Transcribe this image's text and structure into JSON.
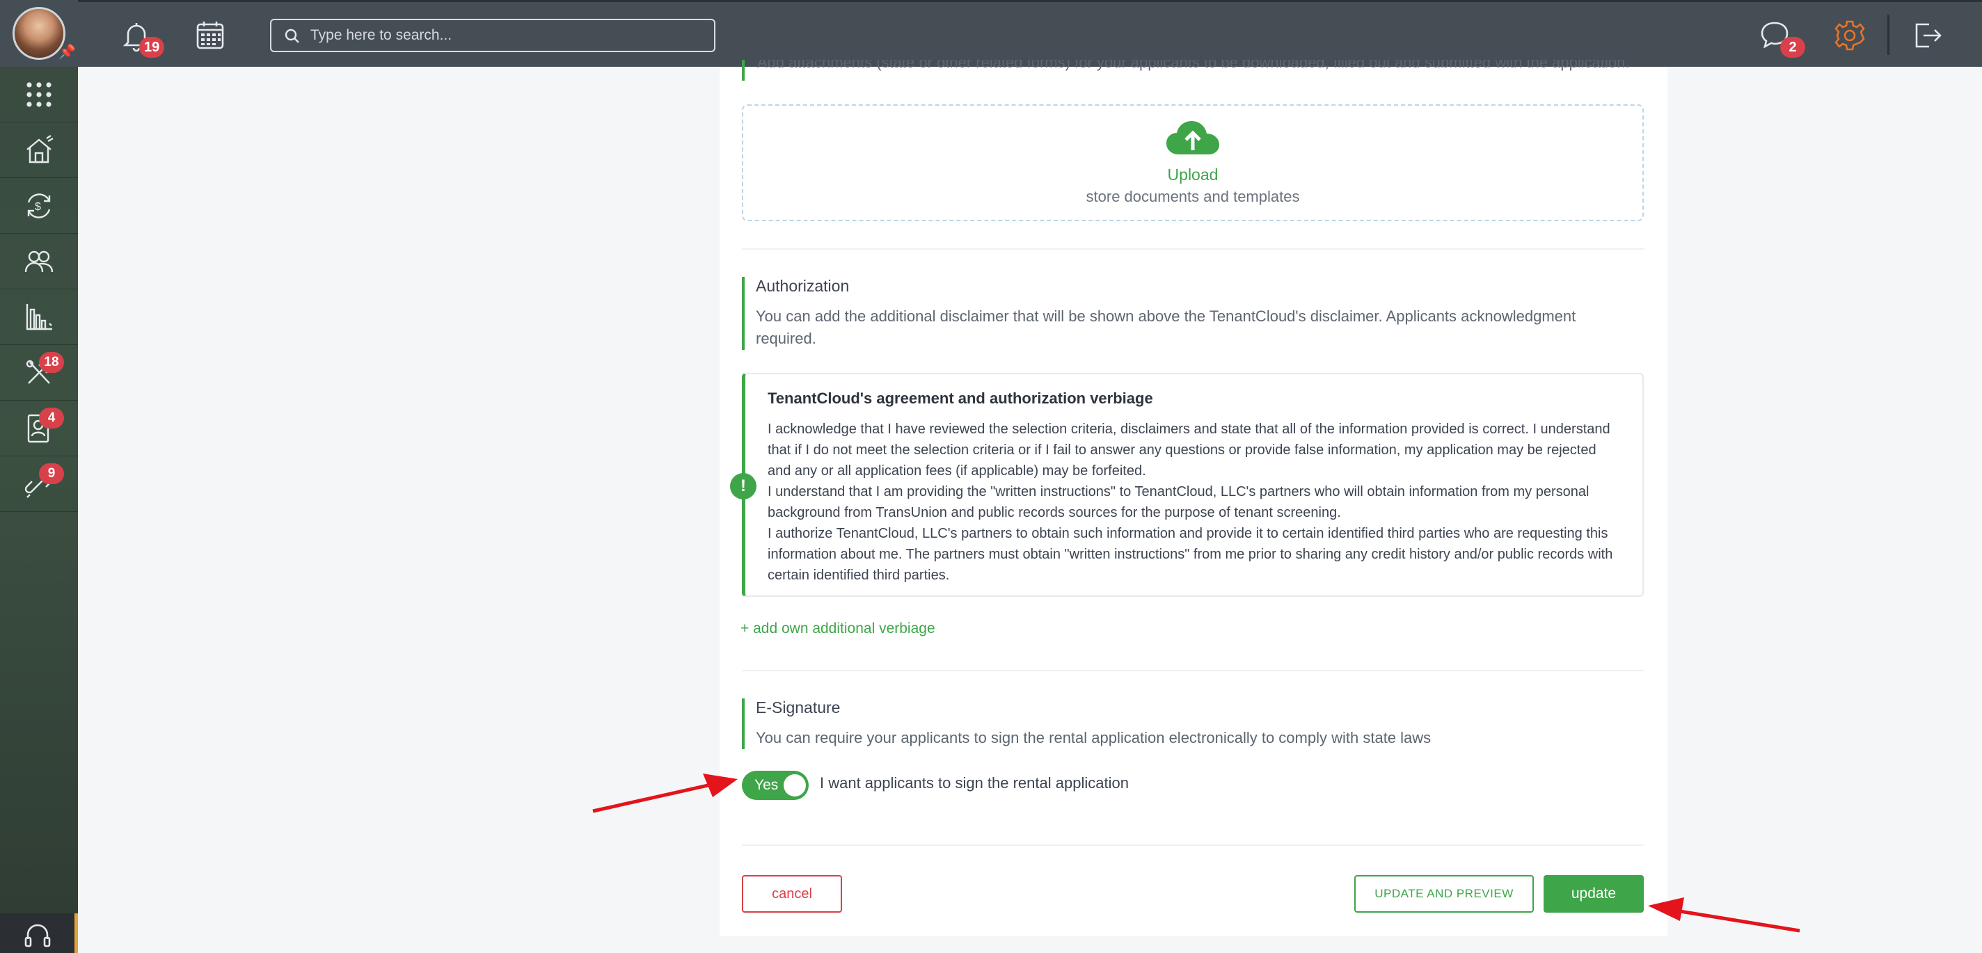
{
  "topbar": {
    "search_placeholder": "Type here to search...",
    "notifications_badge": "19",
    "messages_badge": "2"
  },
  "sidebar": {
    "items": [
      {
        "name": "apps",
        "icon": "apps-grid-icon",
        "badge": ""
      },
      {
        "name": "properties",
        "icon": "house-icon",
        "badge": ""
      },
      {
        "name": "accounting",
        "icon": "money-cycle-icon",
        "badge": ""
      },
      {
        "name": "contacts",
        "icon": "people-icon",
        "badge": ""
      },
      {
        "name": "reports",
        "icon": "bar-chart-icon",
        "badge": ""
      },
      {
        "name": "maintenance",
        "icon": "tools-icon",
        "badge": "18"
      },
      {
        "name": "applications",
        "icon": "applicant-icon",
        "badge": "4"
      },
      {
        "name": "listings",
        "icon": "link-icon",
        "badge": "9"
      }
    ]
  },
  "attachments": {
    "description": "Add attachments (state or other related forms) for your applicants to be downloaded, filled out and submitted with the application.",
    "upload_label": "Upload",
    "upload_sub": "store documents and templates"
  },
  "authorization": {
    "title": "Authorization",
    "description": "You can add the additional disclaimer that will be shown above the TenantCloud's disclaimer. Applicants acknowledgment required.",
    "box_title": "TenantCloud's agreement and authorization verbiage",
    "paragraph_1": "I acknowledge that I have reviewed the selection criteria, disclaimers and state that all of the information provided is correct. I understand that if I do not meet the selection criteria or if I fail to answer any questions or provide false information, my application may be rejected and any or all application fees (if applicable) may be forfeited.",
    "paragraph_2": "I understand that I am providing the \"written instructions\" to TenantCloud, LLC's partners who will obtain information from my personal background from TransUnion and public records sources for the purpose of tenant screening.",
    "paragraph_3": "I authorize TenantCloud, LLC's partners to obtain such information and provide it to certain identified third parties who are requesting this information about me. The partners must obtain \"written instructions\" from me prior to sharing any credit history and/or public records with certain identified third parties.",
    "add_link": "+ add own additional verbiage"
  },
  "esignature": {
    "title": "E-Signature",
    "description": "You can require your applicants to sign the rental application electronically to comply with state laws",
    "toggle_label": "Yes",
    "toggle_on": true,
    "toggle_text": "I want applicants to sign the rental application"
  },
  "actions": {
    "cancel_label": "cancel",
    "preview_label": "UPDATE AND PREVIEW",
    "update_label": "update"
  },
  "colors": {
    "accent": "#3fa549",
    "danger": "#d8404a",
    "topbar": "#454d55",
    "settings_icon": "#e8742a",
    "annotation_arrow": "#e3141b"
  }
}
